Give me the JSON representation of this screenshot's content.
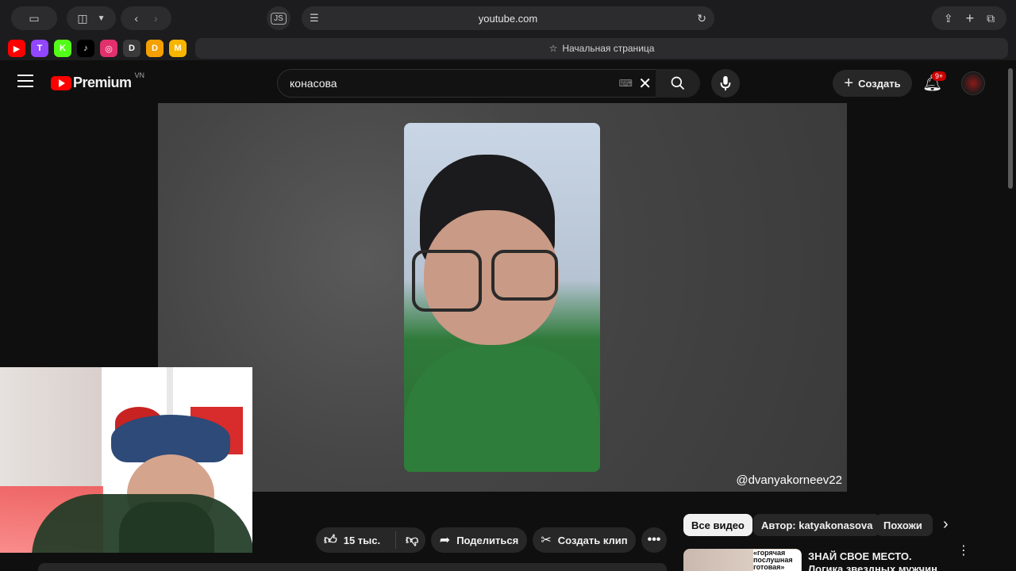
{
  "browser": {
    "url": "youtube.com",
    "js_label": "JS",
    "start_page": "Начальная страница",
    "favorites": [
      {
        "icon": "youtube-icon",
        "color": "#ff0000",
        "glyph": "▶"
      },
      {
        "icon": "twitch-icon",
        "color": "#9146ff",
        "glyph": "T"
      },
      {
        "icon": "kick-icon",
        "color": "#53fc18",
        "glyph": "K"
      },
      {
        "icon": "tiktok-icon",
        "color": "#000000",
        "glyph": "♪"
      },
      {
        "icon": "instagram-icon",
        "color": "#e1306c",
        "glyph": "◎"
      },
      {
        "icon": "dl-icon",
        "color": "#3a3a3a",
        "glyph": "D"
      },
      {
        "icon": "donation-icon",
        "color": "#f59f00",
        "glyph": "D"
      },
      {
        "icon": "m-icon",
        "color": "#f7b500",
        "glyph": "M"
      }
    ]
  },
  "header": {
    "logo_text": "Premium",
    "region": "VN",
    "search_value": "конасова",
    "create_label": "Создать",
    "notifications_badge": "9+"
  },
  "video": {
    "watermark": "@dvanyakorneev22"
  },
  "actions": {
    "likes": "15 тыс.",
    "share": "Поделиться",
    "clip": "Создать клип"
  },
  "chips": [
    "Все видео",
    "Автор: katyakonasova",
    "Похожи"
  ],
  "recommendation": {
    "thumb_caption": "«горячая послушная готовая»",
    "title": "ЗНАЙ СВОЕ МЕСТО. Логика звездных мужчин"
  },
  "colors": {
    "accent": "#ff0000",
    "background": "#0f0f0f"
  }
}
